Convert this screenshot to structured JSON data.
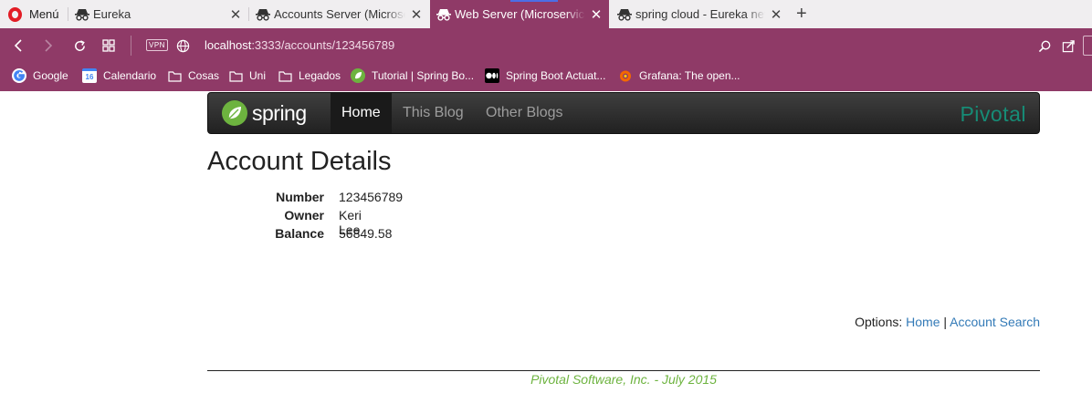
{
  "browser": {
    "menu_label": "Menú",
    "tabs": [
      {
        "title": "Eureka",
        "active": false
      },
      {
        "title": "Accounts Server (Microservices)",
        "active": false
      },
      {
        "title": "Web Server (Microservices Demo)",
        "active": true
      },
      {
        "title": "spring cloud - Eureka never unregisters",
        "active": false
      }
    ],
    "new_tab_symbol": "+",
    "url_host": "localhost",
    "url_path": ":3333/accounts/123456789",
    "vpn_label": "VPN",
    "bookmarks": [
      {
        "label": "Google",
        "icon": "google-icon"
      },
      {
        "label": "Calendario",
        "icon": "calendar-icon",
        "icon_text": "16"
      },
      {
        "label": "Cosas",
        "icon": "folder-icon"
      },
      {
        "label": "Uni",
        "icon": "folder-icon"
      },
      {
        "label": "Legados",
        "icon": "folder-icon"
      },
      {
        "label": "Tutorial | Spring Bo...",
        "icon": "spring-leaf-icon"
      },
      {
        "label": "Spring Boot Actuat...",
        "icon": "medium-icon"
      },
      {
        "label": "Grafana: The open...",
        "icon": "grafana-icon"
      }
    ]
  },
  "site": {
    "logo_text": "spring",
    "nav": [
      {
        "label": "Home",
        "active": true
      },
      {
        "label": "This Blog",
        "active": false
      },
      {
        "label": "Other Blogs",
        "active": false
      }
    ],
    "brand": "Pivotal",
    "colors": {
      "spring_green": "#6db33f",
      "pivotal_teal": "#168c76",
      "link_blue": "#337ab7",
      "browser_plum": "#8f3a67"
    }
  },
  "account": {
    "title": "Account Details",
    "fields": [
      {
        "label": "Number",
        "value": "123456789"
      },
      {
        "label": "Owner",
        "value": "Keri Lee"
      },
      {
        "label": "Balance",
        "value": "56849.58"
      }
    ]
  },
  "options": {
    "label": "Options:",
    "links": [
      "Home",
      "Account Search"
    ],
    "separator": "|"
  },
  "footer": {
    "text": "Pivotal Software, Inc. - July 2015"
  }
}
